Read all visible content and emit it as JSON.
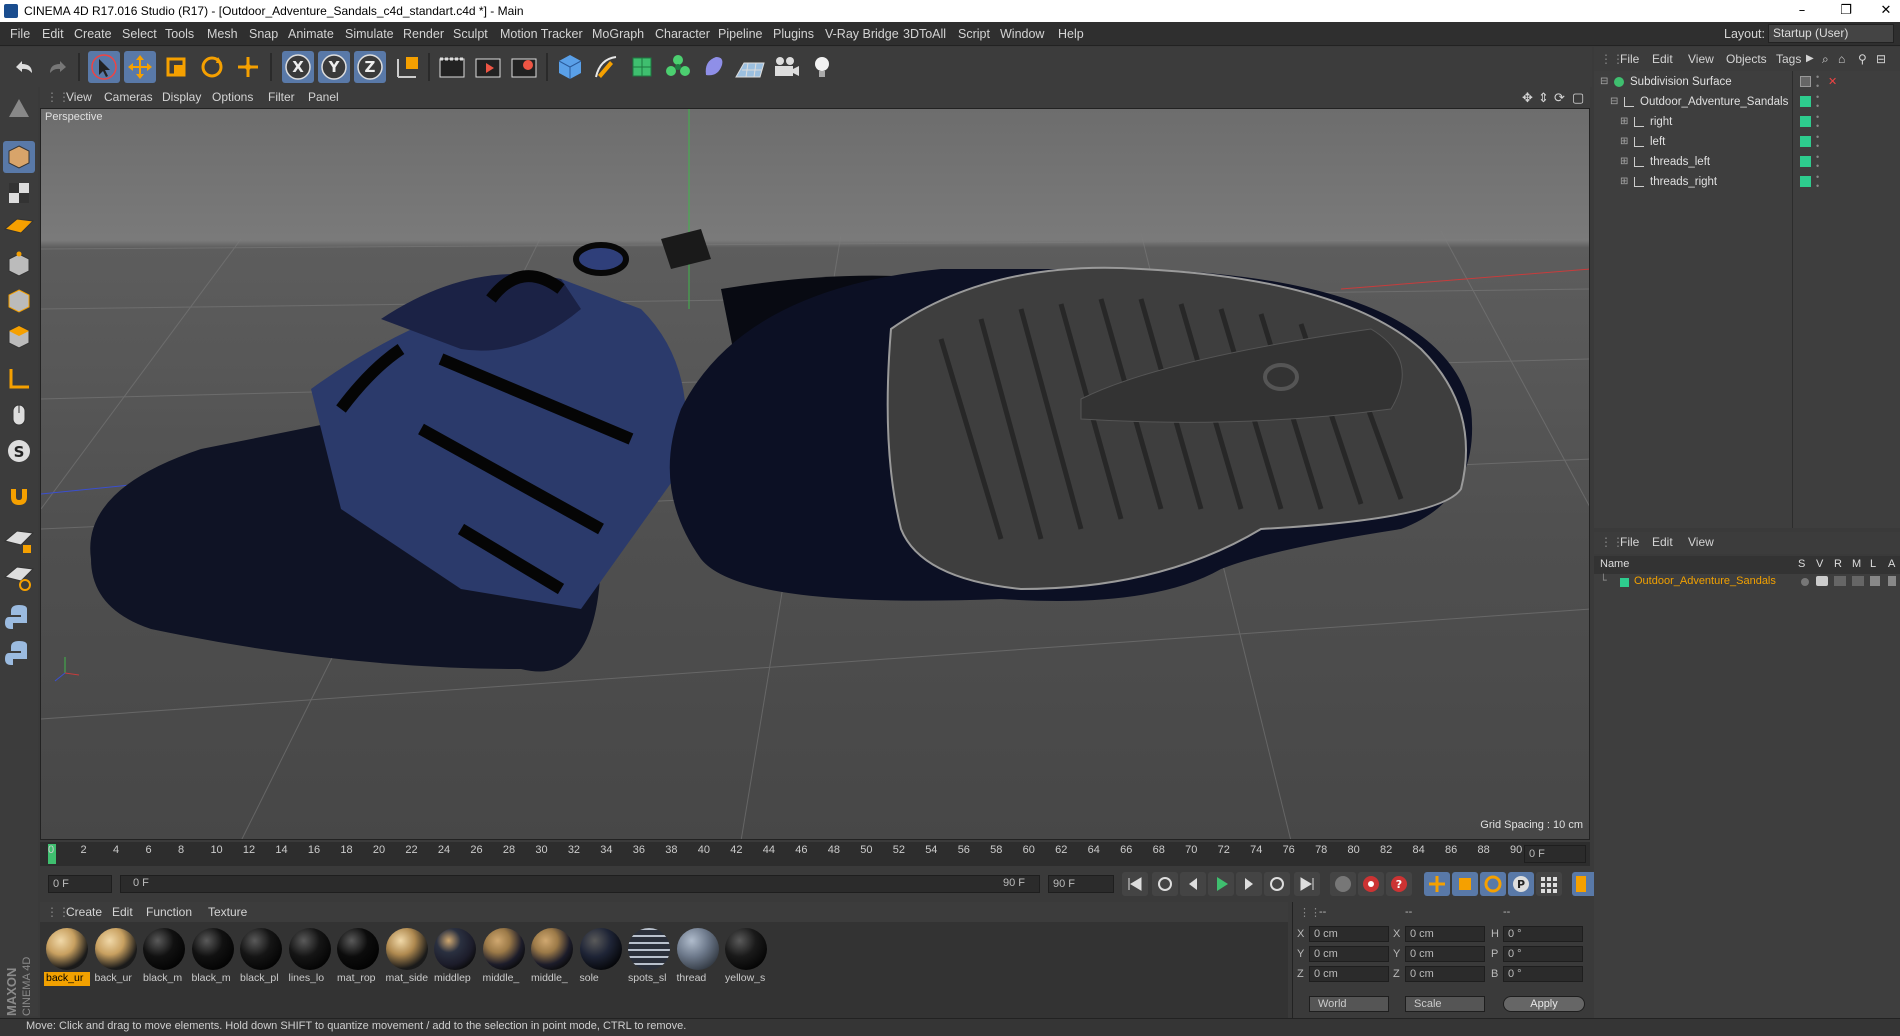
{
  "window": {
    "title": "CINEMA 4D R17.016 Studio (R17) - [Outdoor_Adventure_Sandals_c4d_standart.c4d *] - Main",
    "minimize": "–",
    "restore": "❐",
    "close": "✕"
  },
  "menubar": {
    "items": [
      "File",
      "Edit",
      "Create",
      "Select",
      "Tools",
      "Mesh",
      "Snap",
      "Animate",
      "Simulate",
      "Render",
      "Sculpt",
      "Motion Tracker",
      "MoGraph",
      "Character",
      "Pipeline",
      "Plugins",
      "V-Ray Bridge",
      "3DToAll",
      "Script",
      "Window",
      "Help"
    ],
    "layout_label": "Layout:",
    "layout_value": "Startup (User)"
  },
  "toolbar": {
    "icons": [
      "undo-icon",
      "redo-icon",
      "live-selection-icon",
      "move-icon",
      "scale-icon",
      "rotate-icon",
      "recent-tools-icon",
      "x-axis-icon",
      "y-axis-icon",
      "z-axis-icon",
      "world-coord-icon",
      "render-view-icon",
      "render-picture-viewer-icon",
      "render-settings-icon",
      "cube-icon",
      "pen-icon",
      "subdivision-icon",
      "cloner-icon",
      "deformer-icon",
      "floor-icon",
      "camera-icon",
      "light-icon"
    ],
    "axis_labels": [
      "X",
      "Y",
      "Z"
    ]
  },
  "viewport": {
    "menu": [
      "View",
      "Cameras",
      "Display",
      "Options",
      "Filter",
      "Panel"
    ],
    "label": "Perspective",
    "grid_spacing": "Grid Spacing : 10 cm"
  },
  "timeline": {
    "ticks": [
      "0",
      "2",
      "4",
      "6",
      "8",
      "10",
      "12",
      "14",
      "16",
      "18",
      "20",
      "22",
      "24",
      "26",
      "28",
      "30",
      "32",
      "34",
      "36",
      "38",
      "40",
      "42",
      "44",
      "46",
      "48",
      "50",
      "52",
      "54",
      "56",
      "58",
      "60",
      "62",
      "64",
      "66",
      "68",
      "70",
      "72",
      "74",
      "76",
      "78",
      "80",
      "82",
      "84",
      "86",
      "88",
      "90"
    ],
    "current_frame": "0 F"
  },
  "transport": {
    "start": "0 F",
    "range_start": "0 F",
    "range_end": "90 F",
    "end": "90 F"
  },
  "materials": {
    "menu": [
      "Create",
      "Edit",
      "Function",
      "Texture"
    ],
    "items": [
      {
        "name": "back_ur",
        "color": "#c8a060",
        "style": "tan"
      },
      {
        "name": "back_ur",
        "color": "#c8a060",
        "style": "tan"
      },
      {
        "name": "black_m",
        "color": "#111",
        "style": "dark"
      },
      {
        "name": "black_m",
        "color": "#111",
        "style": "dark"
      },
      {
        "name": "black_pl",
        "color": "#151515",
        "style": "dark"
      },
      {
        "name": "lines_lo",
        "color": "#151515",
        "style": "dark"
      },
      {
        "name": "mat_rop",
        "color": "#0c0c0c",
        "style": "dark"
      },
      {
        "name": "mat_side",
        "color": "#b08a50",
        "style": "tan"
      },
      {
        "name": "middlep",
        "color": "#2a3040",
        "style": "camo"
      },
      {
        "name": "middle_",
        "color": "#9c7a48",
        "style": "camo"
      },
      {
        "name": "middle_",
        "color": "#9c7a48",
        "style": "camo"
      },
      {
        "name": "sole",
        "color": "#1e2436",
        "style": "dark"
      },
      {
        "name": "spots_sl",
        "color": "#2a2f3a",
        "style": "stripe"
      },
      {
        "name": "thread",
        "color": "#6e7a8c",
        "style": "stone"
      },
      {
        "name": "yellow_s",
        "color": "#1a1a1a",
        "style": "dark"
      }
    ]
  },
  "coords": {
    "headers": [
      "--",
      "--",
      "--"
    ],
    "rows": [
      {
        "a": "X",
        "av": "0 cm",
        "b": "X",
        "bv": "0 cm",
        "c": "H",
        "cv": "0 °"
      },
      {
        "a": "Y",
        "av": "0 cm",
        "b": "Y",
        "bv": "0 cm",
        "c": "P",
        "cv": "0 °"
      },
      {
        "a": "Z",
        "av": "0 cm",
        "b": "Z",
        "bv": "0 cm",
        "c": "B",
        "cv": "0 °"
      }
    ],
    "mode1": "World",
    "mode2": "Scale",
    "apply": "Apply"
  },
  "objects": {
    "menu": [
      "File",
      "Edit",
      "View",
      "Objects",
      "Tags"
    ],
    "tree": [
      {
        "name": "Subdivision Surface",
        "level": 0
      },
      {
        "name": "Outdoor_Adventure_Sandals",
        "level": 1
      },
      {
        "name": "right",
        "level": 2
      },
      {
        "name": "left",
        "level": 2
      },
      {
        "name": "threads_left",
        "level": 2
      },
      {
        "name": "threads_right",
        "level": 2
      }
    ]
  },
  "layers": {
    "menu": [
      "File",
      "Edit",
      "View"
    ],
    "header": {
      "name": "Name",
      "cols": [
        "S",
        "V",
        "R",
        "M",
        "L",
        "A"
      ]
    },
    "row": "Outdoor_Adventure_Sandals"
  },
  "status": "Move: Click and drag to move elements. Hold down SHIFT to quantize movement / add to the selection in point mode, CTRL to remove.",
  "brand": {
    "line1": "MAXON",
    "line2": "CINEMA 4D"
  },
  "colors": {
    "accent": "#5979a8",
    "orange": "#f2a100",
    "green_tag": "#2ecc8e"
  }
}
